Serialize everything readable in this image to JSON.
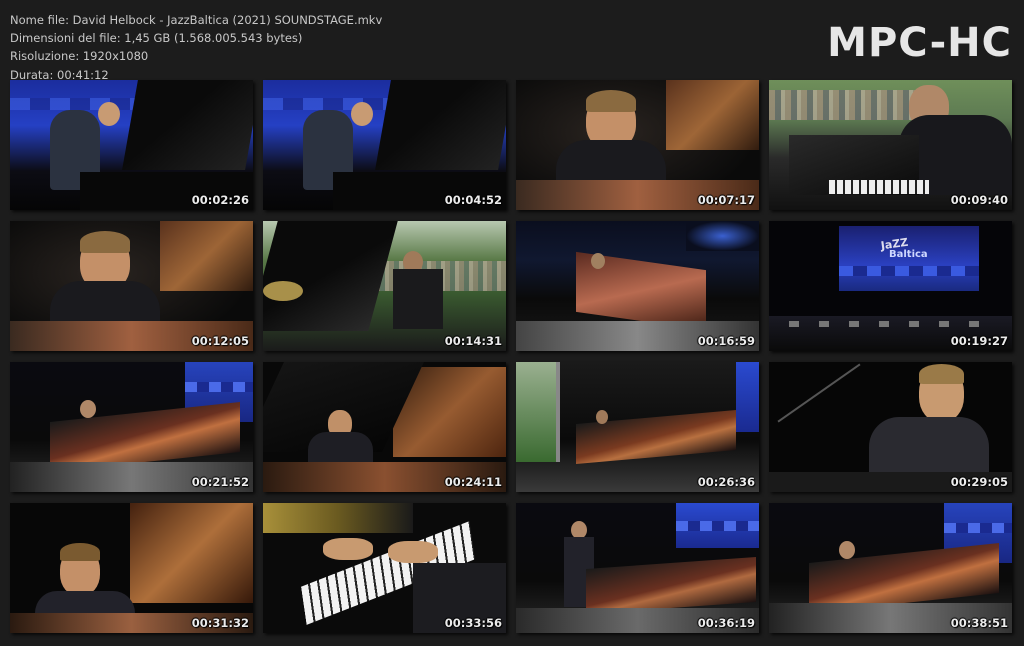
{
  "file_info": {
    "name": "Nome file: David Helbock - JazzBaltica (2021) SOUNDSTAGE.mkv",
    "size": "Dimensioni del file: 1,45 GB (1.568.005.543 bytes)",
    "resolution": "Risoluzione: 1920x1080",
    "duration": "Durata: 00:41:12"
  },
  "logo": "MPC-HC",
  "thumbnails": [
    {
      "timestamp": "00:02:26",
      "scene": "blue-stage-wide"
    },
    {
      "timestamp": "00:04:52",
      "scene": "blue-stage-wide"
    },
    {
      "timestamp": "00:07:17",
      "scene": "closeup-warm"
    },
    {
      "timestamp": "00:09:40",
      "scene": "outdoor-crowd-closeup"
    },
    {
      "timestamp": "00:12:05",
      "scene": "closeup-warm"
    },
    {
      "timestamp": "00:14:31",
      "scene": "outdoor-park"
    },
    {
      "timestamp": "00:16:59",
      "scene": "dark-stage-piano"
    },
    {
      "timestamp": "00:19:27",
      "scene": "stage-banner"
    },
    {
      "timestamp": "00:21:52",
      "scene": "piano-blue-side"
    },
    {
      "timestamp": "00:24:11",
      "scene": "piano-lid-warm"
    },
    {
      "timestamp": "00:26:36",
      "scene": "outdoor-stage-truss"
    },
    {
      "timestamp": "00:29:05",
      "scene": "closeup-dark"
    },
    {
      "timestamp": "00:31:32",
      "scene": "smile-closeup"
    },
    {
      "timestamp": "00:33:56",
      "scene": "hands-keys"
    },
    {
      "timestamp": "00:36:19",
      "scene": "standing-blue"
    },
    {
      "timestamp": "00:38:51",
      "scene": "piano-blue-side"
    }
  ],
  "colors": {
    "background": "#1c1c1c",
    "text": "#c8c8c8",
    "logo": "#e6e6e6",
    "stage_blue": "#2b3fb0",
    "warm_wood": "#b8643a"
  }
}
